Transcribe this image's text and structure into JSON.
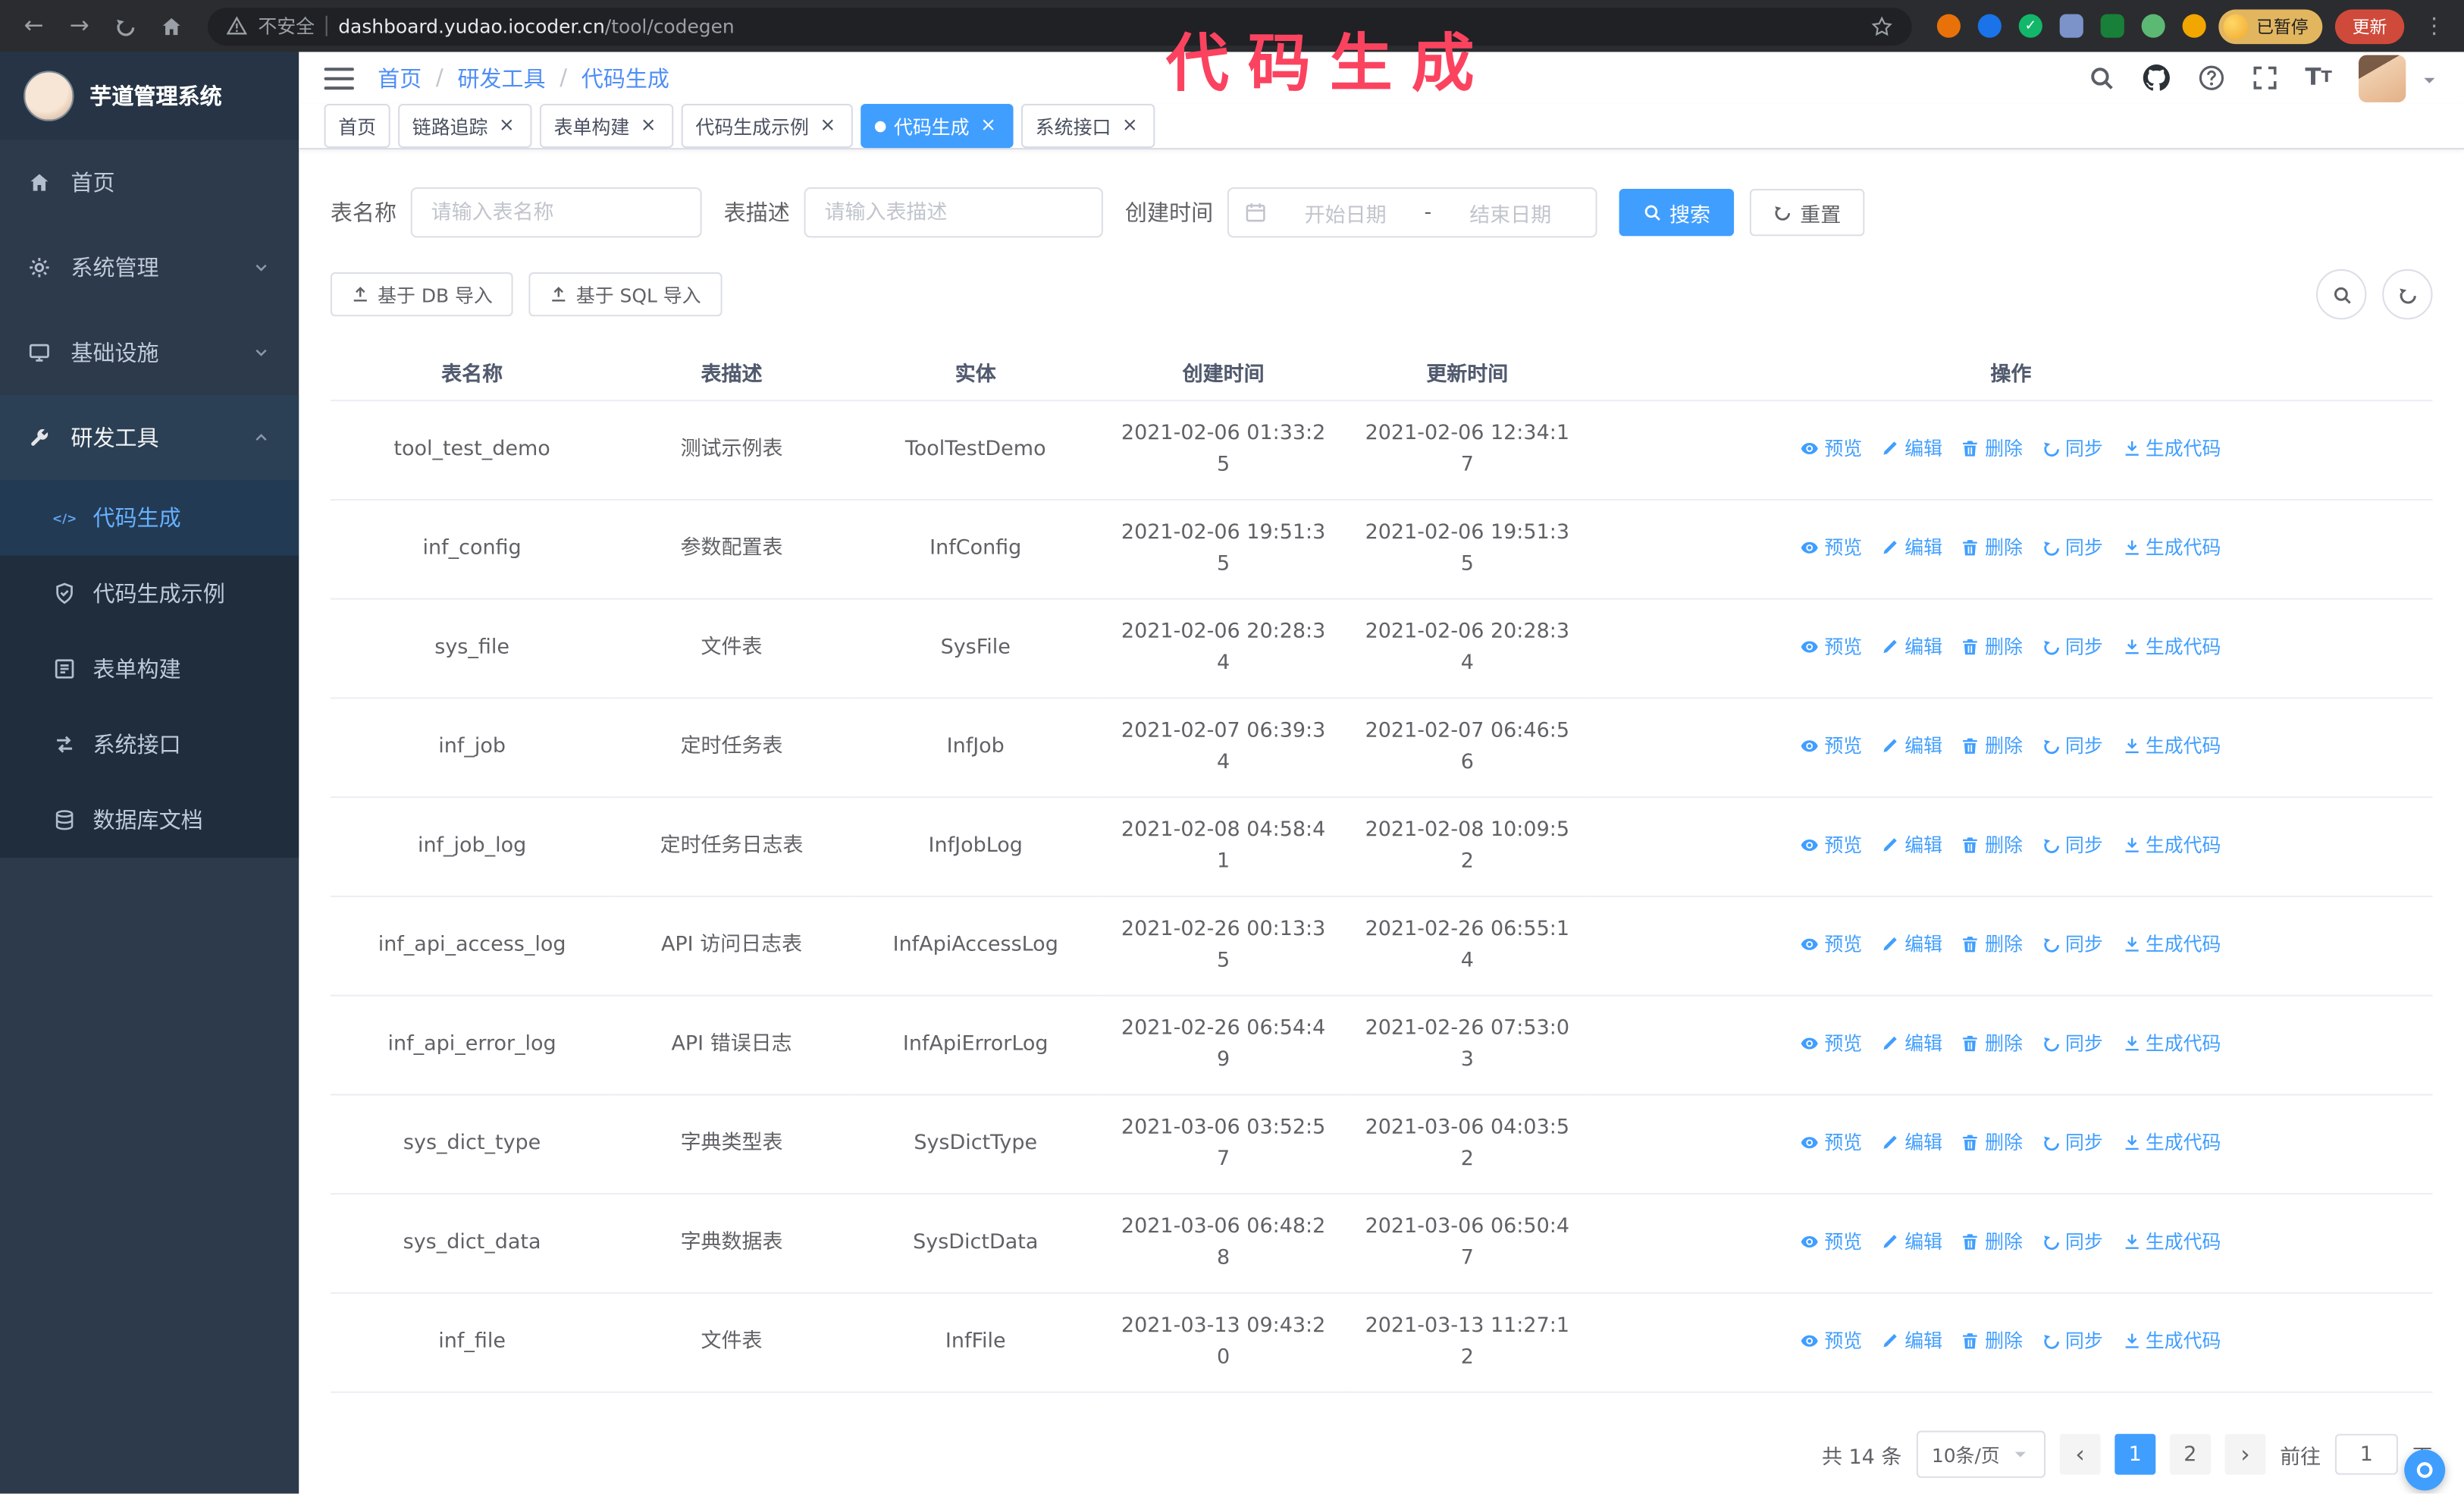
{
  "colors": {
    "accent": "#409eff",
    "annotation_pink": "#fb4360",
    "sidebar_bg": "#2d3a4b",
    "submenu_bg": "#1f2d3d",
    "update_button_bg": "#cf4a3b",
    "profile_badge_bg": "#e2b65f"
  },
  "annotation": {
    "text": "代码生成"
  },
  "browser": {
    "nav_icons": [
      "back-icon",
      "forward-icon",
      "reload-icon",
      "home-icon"
    ],
    "security_label": "不安全",
    "url_domain": "dashboard.yudao.iocoder.cn",
    "url_path": "/tool/codegen",
    "star_icon": "star-icon",
    "extensions_icons": [
      "extension-icon",
      "extension-icon",
      "extension-icon",
      "extension-icon",
      "extension-icon",
      "extension-icon",
      "extension-icon"
    ],
    "profile_badge": "已暂停",
    "update_button": "更新",
    "menu_icon": "kebab-menu-icon"
  },
  "sidebar": {
    "logo_title": "芋道管理系统",
    "items": [
      {
        "id": "home",
        "label": "首页",
        "icon": "home-icon"
      },
      {
        "id": "system",
        "label": "系统管理",
        "icon": "gear-icon",
        "expandable": true
      },
      {
        "id": "infra",
        "label": "基础设施",
        "icon": "monitor-icon",
        "expandable": true
      },
      {
        "id": "devtools",
        "label": "研发工具",
        "icon": "tools-icon",
        "expandable": true,
        "expanded": true,
        "children": [
          {
            "id": "codegen",
            "label": "代码生成",
            "icon": "code-icon",
            "active": true
          },
          {
            "id": "codegen-demo",
            "label": "代码生成示例",
            "icon": "badge-icon"
          },
          {
            "id": "form-build",
            "label": "表单构建",
            "icon": "form-icon"
          },
          {
            "id": "api",
            "label": "系统接口",
            "icon": "api-icon"
          },
          {
            "id": "db-doc",
            "label": "数据库文档",
            "icon": "database-icon"
          }
        ]
      }
    ]
  },
  "header": {
    "breadcrumb": [
      "首页",
      "研发工具",
      "代码生成"
    ],
    "right_icons": [
      "search-icon",
      "github-icon",
      "question-icon",
      "fullscreen-icon",
      "font-size-icon",
      "avatar",
      "caret-down-icon"
    ]
  },
  "tabs": [
    {
      "id": "home",
      "label": "首页",
      "closable": false,
      "active": false
    },
    {
      "id": "trace",
      "label": "链路追踪",
      "closable": true,
      "active": false
    },
    {
      "id": "form-build",
      "label": "表单构建",
      "closable": true,
      "active": false
    },
    {
      "id": "codegen-demo",
      "label": "代码生成示例",
      "closable": true,
      "active": false
    },
    {
      "id": "codegen",
      "label": "代码生成",
      "closable": true,
      "active": true
    },
    {
      "id": "api",
      "label": "系统接口",
      "closable": true,
      "active": false
    }
  ],
  "filters": {
    "table_name": {
      "label": "表名称",
      "placeholder": "请输入表名称",
      "value": ""
    },
    "table_desc": {
      "label": "表描述",
      "placeholder": "请输入表描述",
      "value": ""
    },
    "create_time": {
      "label": "创建时间",
      "icon": "calendar-icon",
      "start_placeholder": "开始日期",
      "separator": "-",
      "end_placeholder": "结束日期"
    },
    "search_button": "搜索",
    "reset_button": "重置"
  },
  "toolbar": {
    "import_db": "基于 DB 导入",
    "import_sql": "基于 SQL 导入",
    "icon_buttons": [
      "search-icon",
      "refresh-icon"
    ]
  },
  "table": {
    "headers": [
      "表名称",
      "表描述",
      "实体",
      "创建时间",
      "更新时间",
      "操作"
    ],
    "row_actions": [
      {
        "id": "preview",
        "label": "预览",
        "icon": "eye-icon"
      },
      {
        "id": "edit",
        "label": "编辑",
        "icon": "edit-icon"
      },
      {
        "id": "delete",
        "label": "删除",
        "icon": "delete-icon"
      },
      {
        "id": "sync",
        "label": "同步",
        "icon": "sync-icon"
      },
      {
        "id": "generate",
        "label": "生成代码",
        "icon": "download-icon"
      }
    ],
    "rows": [
      {
        "name": "tool_test_demo",
        "desc": "测试示例表",
        "entity": "ToolTestDemo",
        "create_time": "2021-02-06 01:33:25",
        "update_time": "2021-02-06 12:34:17"
      },
      {
        "name": "inf_config",
        "desc": "参数配置表",
        "entity": "InfConfig",
        "create_time": "2021-02-06 19:51:35",
        "update_time": "2021-02-06 19:51:35"
      },
      {
        "name": "sys_file",
        "desc": "文件表",
        "entity": "SysFile",
        "create_time": "2021-02-06 20:28:34",
        "update_time": "2021-02-06 20:28:34"
      },
      {
        "name": "inf_job",
        "desc": "定时任务表",
        "entity": "InfJob",
        "create_time": "2021-02-07 06:39:34",
        "update_time": "2021-02-07 06:46:56"
      },
      {
        "name": "inf_job_log",
        "desc": "定时任务日志表",
        "entity": "InfJobLog",
        "create_time": "2021-02-08 04:58:41",
        "update_time": "2021-02-08 10:09:52"
      },
      {
        "name": "inf_api_access_log",
        "desc": "API 访问日志表",
        "entity": "InfApiAccessLog",
        "create_time": "2021-02-26 00:13:35",
        "update_time": "2021-02-26 06:55:14"
      },
      {
        "name": "inf_api_error_log",
        "desc": "API 错误日志",
        "entity": "InfApiErrorLog",
        "create_time": "2021-02-26 06:54:49",
        "update_time": "2021-02-26 07:53:03"
      },
      {
        "name": "sys_dict_type",
        "desc": "字典类型表",
        "entity": "SysDictType",
        "create_time": "2021-03-06 03:52:57",
        "update_time": "2021-03-06 04:03:52"
      },
      {
        "name": "sys_dict_data",
        "desc": "字典数据表",
        "entity": "SysDictData",
        "create_time": "2021-03-06 06:48:28",
        "update_time": "2021-03-06 06:50:47"
      },
      {
        "name": "inf_file",
        "desc": "文件表",
        "entity": "InfFile",
        "create_time": "2021-03-13 09:43:20",
        "update_time": "2021-03-13 11:27:12"
      }
    ]
  },
  "pagination": {
    "total": "共 14 条",
    "page_size": "10条/页",
    "pages": [
      "1",
      "2"
    ],
    "current_page": "1",
    "goto_label": "前往",
    "goto_value": "1",
    "goto_unit": "页"
  }
}
